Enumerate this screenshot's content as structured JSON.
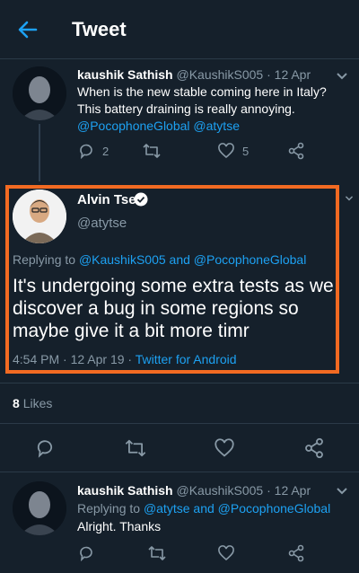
{
  "header": {
    "title": "Tweet",
    "back_icon": "arrow-left-icon",
    "accent": "#1da1f2"
  },
  "tweet1": {
    "name": "kaushik Sathish",
    "handle": "@KaushikS005",
    "sep": "·",
    "date": "12 Apr",
    "text": "When is the new stable coming here in Italy? This battery draining is really annoying.",
    "mentions": "@PocophoneGlobal @atytse",
    "reply_count": "2",
    "like_count": "5"
  },
  "main_tweet": {
    "name": "Alvin Tse",
    "handle": "@atytse",
    "replying_prefix": "Replying to",
    "replying_user1": "@KaushikS005",
    "replying_and": "and",
    "replying_user2": "@PocophoneGlobal",
    "text": "It's undergoing some extra tests as we discover a bug in some regions so maybe give it a bit more timr",
    "time": "4:54 PM",
    "sep1": "·",
    "date": "12 Apr 19",
    "sep2": "·",
    "source": "Twitter for Android",
    "highlight_color": "#f26a22"
  },
  "likes": {
    "count": "8",
    "label": "Likes"
  },
  "tweet3": {
    "name": "kaushik Sathish",
    "handle": "@KaushikS005",
    "sep": "·",
    "date": "12 Apr",
    "replying_prefix": "Replying to",
    "replying_user1": "@atytse",
    "replying_and": "and",
    "replying_user2": "@PocophoneGlobal",
    "text": "Alright. Thanks"
  }
}
